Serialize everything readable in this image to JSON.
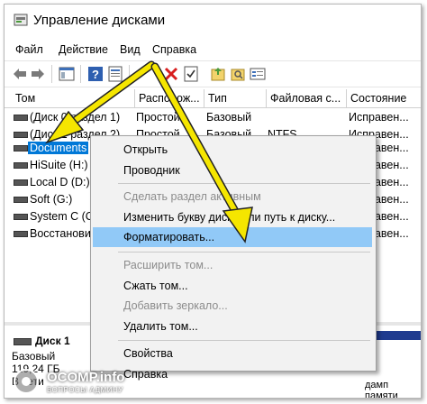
{
  "window": {
    "title": "Управление дисками"
  },
  "menu": [
    "Файл",
    "Действие",
    "Вид",
    "Справка"
  ],
  "toolbar_icons": [
    "back-arrow-icon",
    "forward-arrow-icon",
    "console-tree-icon",
    "help-icon",
    "properties-icon",
    "delete-icon",
    "check-icon",
    "folder-icon",
    "search-icon",
    "list-view-icon"
  ],
  "columns": [
    "Том",
    "Располож...",
    "Тип",
    "Файловая с...",
    "Состояние"
  ],
  "volumes": [
    {
      "name": "(Диск 0 раздел 1)",
      "layout": "Простой",
      "type": "Базовый",
      "fs": "",
      "status": "Исправен..."
    },
    {
      "name": "(Диск 1 раздел 2)",
      "layout": "Простой",
      "type": "Базовый",
      "fs": "NTFS",
      "status": "Исправен..."
    },
    {
      "name": "Documents",
      "layout": "",
      "type": "",
      "fs": "",
      "status": "Исправен..."
    },
    {
      "name": "HiSuite (H:)",
      "layout": "",
      "type": "",
      "fs": "",
      "status": "Исправен..."
    },
    {
      "name": "Local D (D:)",
      "layout": "",
      "type": "",
      "fs": "",
      "status": "Исправен..."
    },
    {
      "name": "Soft (G:)",
      "layout": "",
      "type": "",
      "fs": "",
      "status": "Исправен..."
    },
    {
      "name": "System C (C:)",
      "layout": "",
      "type": "",
      "fs": "",
      "status": "Исправен..."
    },
    {
      "name": "Восстановить",
      "layout": "",
      "type": "",
      "fs": "",
      "status": "Исправен..."
    }
  ],
  "context_menu": [
    {
      "label": "Открыть",
      "enabled": true
    },
    {
      "label": "Проводник",
      "enabled": true
    },
    {
      "label": "Сделать раздел активным",
      "enabled": false
    },
    {
      "label": "Изменить букву диска или путь к диску...",
      "enabled": true
    },
    {
      "label": "Форматировать...",
      "enabled": true,
      "highlighted": true
    },
    {
      "label": "Расширить том...",
      "enabled": false
    },
    {
      "label": "Сжать том...",
      "enabled": true
    },
    {
      "label": "Добавить зеркало...",
      "enabled": false
    },
    {
      "label": "Удалить том...",
      "enabled": true
    },
    {
      "label": "Свойства",
      "enabled": true
    },
    {
      "label": "Справка",
      "enabled": true
    }
  ],
  "disk_info": {
    "name": "Диск 1",
    "type": "Базовый",
    "size": "119,24 ГБ",
    "status": "В сети",
    "tail_text": "дамп памяти"
  },
  "watermark": {
    "site": "OCOMP.info",
    "tagline": "ВОПРОСЫ АДМИНУ"
  },
  "colors": {
    "selection": "#0078d7",
    "menu_highlight": "#91c9f7",
    "arrow": "#f5e600",
    "disk_bar": "#1f3b8f"
  }
}
